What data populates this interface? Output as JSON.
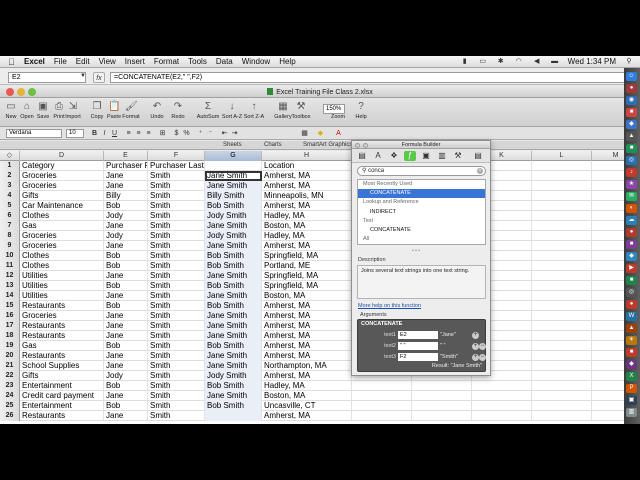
{
  "menubar": {
    "apple": "",
    "menus": [
      "Excel",
      "File",
      "Edit",
      "View",
      "Insert",
      "Format",
      "Tools",
      "Data",
      "Window",
      "Help"
    ],
    "clock": "Wed 1:34 PM"
  },
  "formula_bar": {
    "name_box": "E2",
    "fx": "fx",
    "formula": "=CONCATENATE(E2,\" \",F2)"
  },
  "window": {
    "title": "Excel Training File Class 2.xlsx"
  },
  "toolbar": {
    "items": [
      {
        "icon": "new-icon",
        "glyph": "▭",
        "label": "New"
      },
      {
        "icon": "open-icon",
        "glyph": "⌂",
        "label": "Open"
      },
      {
        "icon": "save-icon",
        "glyph": "▣",
        "label": "Save"
      },
      {
        "icon": "print-icon",
        "glyph": "⎙",
        "label": "Print"
      },
      {
        "icon": "import-icon",
        "glyph": "⇲",
        "label": "Import"
      },
      {
        "icon": "copy-icon",
        "glyph": "❐",
        "label": "Copy"
      },
      {
        "icon": "paste-icon",
        "glyph": "📋",
        "label": "Paste"
      },
      {
        "icon": "format-icon",
        "glyph": "🖌",
        "label": "Format"
      },
      {
        "icon": "undo-icon",
        "glyph": "↶",
        "label": "Undo"
      },
      {
        "icon": "redo-icon",
        "glyph": "↷",
        "label": "Redo"
      },
      {
        "icon": "autosum-icon",
        "glyph": "Σ",
        "label": "AutoSum"
      },
      {
        "icon": "sort-az-icon",
        "glyph": "↓",
        "label": "Sort A-Z"
      },
      {
        "icon": "sort-za-icon",
        "glyph": "↑",
        "label": "Sort Z-A"
      },
      {
        "icon": "gallery-icon",
        "glyph": "▦",
        "label": "Gallery"
      },
      {
        "icon": "toolbox-icon",
        "glyph": "⚒",
        "label": "Toolbox"
      },
      {
        "icon": "zoom-icon",
        "glyph": "",
        "label": "Zoom"
      },
      {
        "icon": "help-icon",
        "glyph": "?",
        "label": "Help"
      }
    ],
    "zoom_value": "150%"
  },
  "format_bar": {
    "font": "Verdana",
    "size": "10"
  },
  "ribbon_tabs": [
    "Sheets",
    "Charts",
    "SmartArt Graphics"
  ],
  "columns": [
    "D",
    "E",
    "F",
    "G",
    "H",
    "I",
    "J",
    "K",
    "L",
    "M"
  ],
  "rows": [
    {
      "n": "1",
      "D": "Category",
      "E": "Purchaser First",
      "F": "Purchaser Last",
      "G": "",
      "H": "Location"
    },
    {
      "n": "2",
      "D": "Groceries",
      "E": "Jane",
      "F": "Smith",
      "G": "Jane Smith",
      "H": "Amherst, MA"
    },
    {
      "n": "3",
      "D": "Groceries",
      "E": "Jane",
      "F": "Smith",
      "G": "Jane Smith",
      "H": "Amherst, MA"
    },
    {
      "n": "4",
      "D": "Gifts",
      "E": "Billy",
      "F": "Smith",
      "G": "Billy Smith",
      "H": "Minneapolis, MN"
    },
    {
      "n": "5",
      "D": "Car Maintenance",
      "E": "Bob",
      "F": "Smith",
      "G": "Bob Smith",
      "H": "Amherst, MA"
    },
    {
      "n": "6",
      "D": "Clothes",
      "E": "Jody",
      "F": "Smith",
      "G": "Jody Smith",
      "H": "Hadley, MA"
    },
    {
      "n": "7",
      "D": "Gas",
      "E": "Jane",
      "F": "Smith",
      "G": "Jane Smith",
      "H": "Boston, MA"
    },
    {
      "n": "8",
      "D": "Groceries",
      "E": "Jody",
      "F": "Smith",
      "G": "Jody Smith",
      "H": "Hadley, MA"
    },
    {
      "n": "9",
      "D": "Groceries",
      "E": "Jane",
      "F": "Smith",
      "G": "Jane Smith",
      "H": "Amherst, MA"
    },
    {
      "n": "10",
      "D": "Clothes",
      "E": "Bob",
      "F": "Smith",
      "G": "Bob Smith",
      "H": "Springfield, MA"
    },
    {
      "n": "11",
      "D": "Clothes",
      "E": "Bob",
      "F": "Smith",
      "G": "Bob Smith",
      "H": "Portland, ME"
    },
    {
      "n": "12",
      "D": "Utilities",
      "E": "Jane",
      "F": "Smith",
      "G": "Jane Smith",
      "H": "Springfield, MA"
    },
    {
      "n": "13",
      "D": "Utilities",
      "E": "Bob",
      "F": "Smith",
      "G": "Bob Smith",
      "H": "Springfield, MA"
    },
    {
      "n": "14",
      "D": "Utilities",
      "E": "Jane",
      "F": "Smith",
      "G": "Jane Smith",
      "H": "Boston, MA"
    },
    {
      "n": "15",
      "D": "Restaurants",
      "E": "Bob",
      "F": "Smith",
      "G": "Bob Smith",
      "H": "Amherst, MA"
    },
    {
      "n": "16",
      "D": "Groceries",
      "E": "Jane",
      "F": "Smith",
      "G": "Jane Smith",
      "H": "Amherst, MA"
    },
    {
      "n": "17",
      "D": "Restaurants",
      "E": "Jane",
      "F": "Smith",
      "G": "Jane Smith",
      "H": "Amherst, MA"
    },
    {
      "n": "18",
      "D": "Restaurants",
      "E": "Jane",
      "F": "Smith",
      "G": "Jane Smith",
      "H": "Amherst, MA"
    },
    {
      "n": "19",
      "D": "Gas",
      "E": "Bob",
      "F": "Smith",
      "G": "Bob Smith",
      "H": "Amherst, MA"
    },
    {
      "n": "20",
      "D": "Restaurants",
      "E": "Jane",
      "F": "Smith",
      "G": "Jane Smith",
      "H": "Amherst, MA"
    },
    {
      "n": "21",
      "D": "School Supplies",
      "E": "Jane",
      "F": "Smith",
      "G": "Jane Smith",
      "H": "Northampton, MA"
    },
    {
      "n": "22",
      "D": "Gifts",
      "E": "Jody",
      "F": "Smith",
      "G": "Jody Smith",
      "H": "Amherst, MA"
    },
    {
      "n": "23",
      "D": "Entertainment",
      "E": "Bob",
      "F": "Smith",
      "G": "Bob Smith",
      "H": "Hadley, MA"
    },
    {
      "n": "24",
      "D": "Credit card payment",
      "E": "Jane",
      "F": "Smith",
      "G": "Jane Smith",
      "H": "Boston, MA"
    },
    {
      "n": "25",
      "D": "Entertainment",
      "E": "Bob",
      "F": "Smith",
      "G": "Bob Smith",
      "H": "Uncasville, CT"
    },
    {
      "n": "26",
      "D": "Restaurants",
      "E": "Jane",
      "F": "Smith",
      "G": "",
      "H": "Amherst, MA"
    }
  ],
  "formula_builder": {
    "title": "Formula Builder",
    "search": "conca",
    "list": [
      {
        "kind": "cat",
        "text": "Most Recently Used"
      },
      {
        "kind": "fn-sel",
        "text": "CONCATENATE"
      },
      {
        "kind": "cat",
        "text": "Lookup and Reference"
      },
      {
        "kind": "fn",
        "text": "INDIRECT"
      },
      {
        "kind": "cat",
        "text": "Text"
      },
      {
        "kind": "fn",
        "text": "CONCATENATE"
      },
      {
        "kind": "cat",
        "text": "All"
      }
    ],
    "description_label": "Description",
    "description": "Joins several text strings into one text string.",
    "help_link": "More help on this function",
    "arguments_label": "Arguments",
    "function": "CONCATENATE",
    "args": [
      {
        "name": "text1",
        "value": "E2",
        "result": "\"Jane\""
      },
      {
        "name": "text2",
        "value": "\" \"",
        "result": "\" \""
      },
      {
        "name": "text3",
        "value": "F2",
        "result": "\"Smith\""
      }
    ],
    "result": "Result: \"Jane Smith\""
  },
  "colors": {
    "selection_blue": "#3875d7",
    "active_tool_green": "#5ac84a",
    "column_g_highlight": "#e9eef7"
  }
}
